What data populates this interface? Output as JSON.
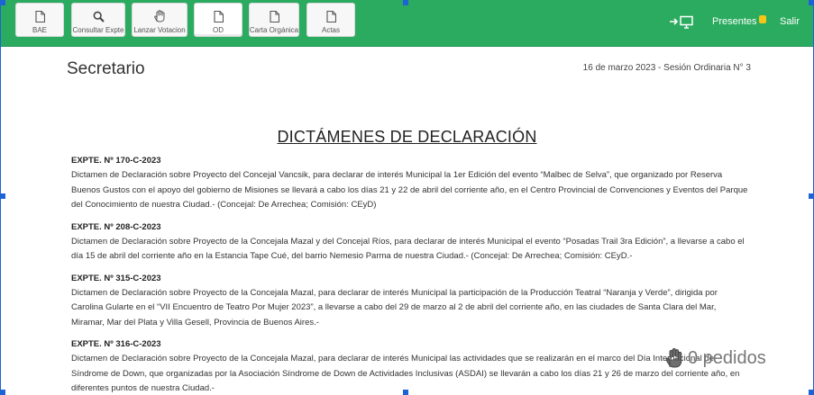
{
  "toolbar": {
    "buttons": [
      {
        "label": "BAE",
        "icon": "document-icon"
      },
      {
        "label": "Consultar Expte",
        "icon": "search-icon"
      },
      {
        "label": "Lanzar Votacion",
        "icon": "hand-icon"
      },
      {
        "label": "OD",
        "icon": "document-icon"
      },
      {
        "label": "Carta Orgánica",
        "icon": "document-icon"
      },
      {
        "label": "Actas",
        "icon": "document-icon"
      }
    ],
    "presentes_label": "Presentes",
    "salir_label": "Salir",
    "accent_color": "#2bab5f",
    "badge_color": "#f5c518"
  },
  "header": {
    "title": "Secretario",
    "session_info": "16 de marzo 2023 - Sesión Ordinaria N° 3"
  },
  "section_heading": "DICTÁMENES DE DECLARACIÓN",
  "items": [
    {
      "title": "EXPTE. Nº 170-C-2023",
      "body": "Dictamen de Declaración sobre Proyecto del Concejal Vancsik, para declarar de interés Municipal la 1er Edición del evento “Malbec de Selva”, que organizado por Reserva Buenos Gustos con el apoyo del gobierno de Misiones se llevará a cabo los días 21 y 22 de abril del corriente año, en el Centro Provincial de Convenciones y Eventos del Parque del Conocimiento de nuestra Ciudad.- (Concejal: De Arrechea; Comisión: CEyD)"
    },
    {
      "title": "EXPTE. Nº 208-C-2023",
      "body": "Dictamen de Declaración sobre Proyecto de la Concejala Mazal y del Concejal Ríos, para declarar de interés Municipal el evento “Posadas Trail 3ra Edición”, a llevarse a cabo el día 15 de abril del corriente año en la Estancia Tape Cué, del barrio Nemesio Parma de nuestra Ciudad.- (Concejal: De Arrechea; Comisión: CEyD.-"
    },
    {
      "title": "EXPTE. Nº 315-C-2023",
      "body": "Dictamen de Declaración sobre Proyecto de la Concejala Mazal, para declarar de interés Municipal la participación de la Producción Teatral “Naranja y Verde”, dirigida por Carolina Gularte en el “VII Encuentro de Teatro Por Mujer 2023”, a llevarse a cabo del 29 de marzo al 2 de abril del corriente año, en las ciudades de Santa Clara del Mar, Miramar, Mar del Plata y Villa Gesell, Provincia de Buenos Aires.-"
    },
    {
      "title": "EXPTE. Nº 316-C-2023",
      "body": "Dictamen de Declaración sobre Proyecto de la Concejala Mazal, para declarar de interés Municipal las actividades que se realizarán en el marco del Día Internacional del Síndrome de Down, que organizadas por la Asociación Síndrome de Down de Actividades Inclusivas (ASDAI) se llevarán a cabo los días 21 y 26 de marzo del corriente año, en diferentes puntos de nuestra Ciudad.-"
    }
  ],
  "pedidos": {
    "count": "0",
    "label": "pedidos",
    "text": "0 pedidos"
  }
}
